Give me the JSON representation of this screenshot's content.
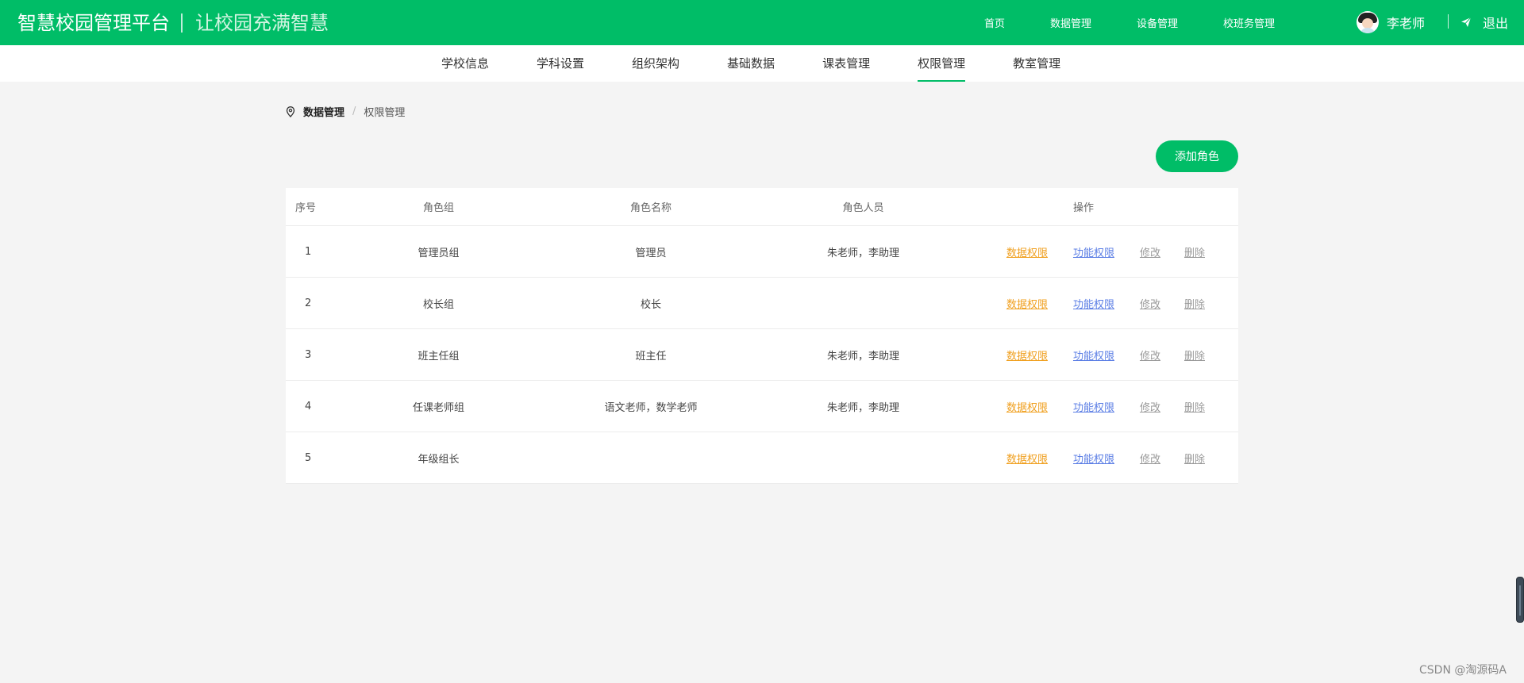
{
  "header": {
    "title": "智慧校园管理平台",
    "slogan": "让校园充满智慧",
    "nav": [
      "首页",
      "数据管理",
      "设备管理",
      "校班务管理"
    ],
    "user_name": "李老师",
    "logout_label": "退出",
    "bg_color": "#00bd67"
  },
  "subnav": {
    "tabs": [
      "学校信息",
      "学科设置",
      "组织架构",
      "基础数据",
      "课表管理",
      "权限管理",
      "教室管理"
    ],
    "active": "权限管理"
  },
  "breadcrumb": {
    "items": [
      "数据管理",
      "权限管理"
    ]
  },
  "actions": {
    "add_role_label": "添加角色"
  },
  "table": {
    "headers": {
      "index": "序号",
      "group": "角色组",
      "name": "角色名称",
      "people": "角色人员",
      "ops": "操作"
    },
    "op_labels": {
      "data": "数据权限",
      "func": "功能权限",
      "edit": "修改",
      "del": "删除"
    },
    "rows": [
      {
        "index": "1",
        "group": "管理员组",
        "name": "管理员",
        "people": "朱老师，李助理"
      },
      {
        "index": "2",
        "group": "校长组",
        "name": "校长",
        "people": ""
      },
      {
        "index": "3",
        "group": "班主任组",
        "name": "班主任",
        "people": "朱老师，李助理"
      },
      {
        "index": "4",
        "group": "任课老师组",
        "name": "语文老师，数学老师",
        "people": "朱老师，李助理"
      },
      {
        "index": "5",
        "group": "年级组长",
        "name": "",
        "people": ""
      }
    ]
  },
  "watermark": "CSDN @淘源码A"
}
